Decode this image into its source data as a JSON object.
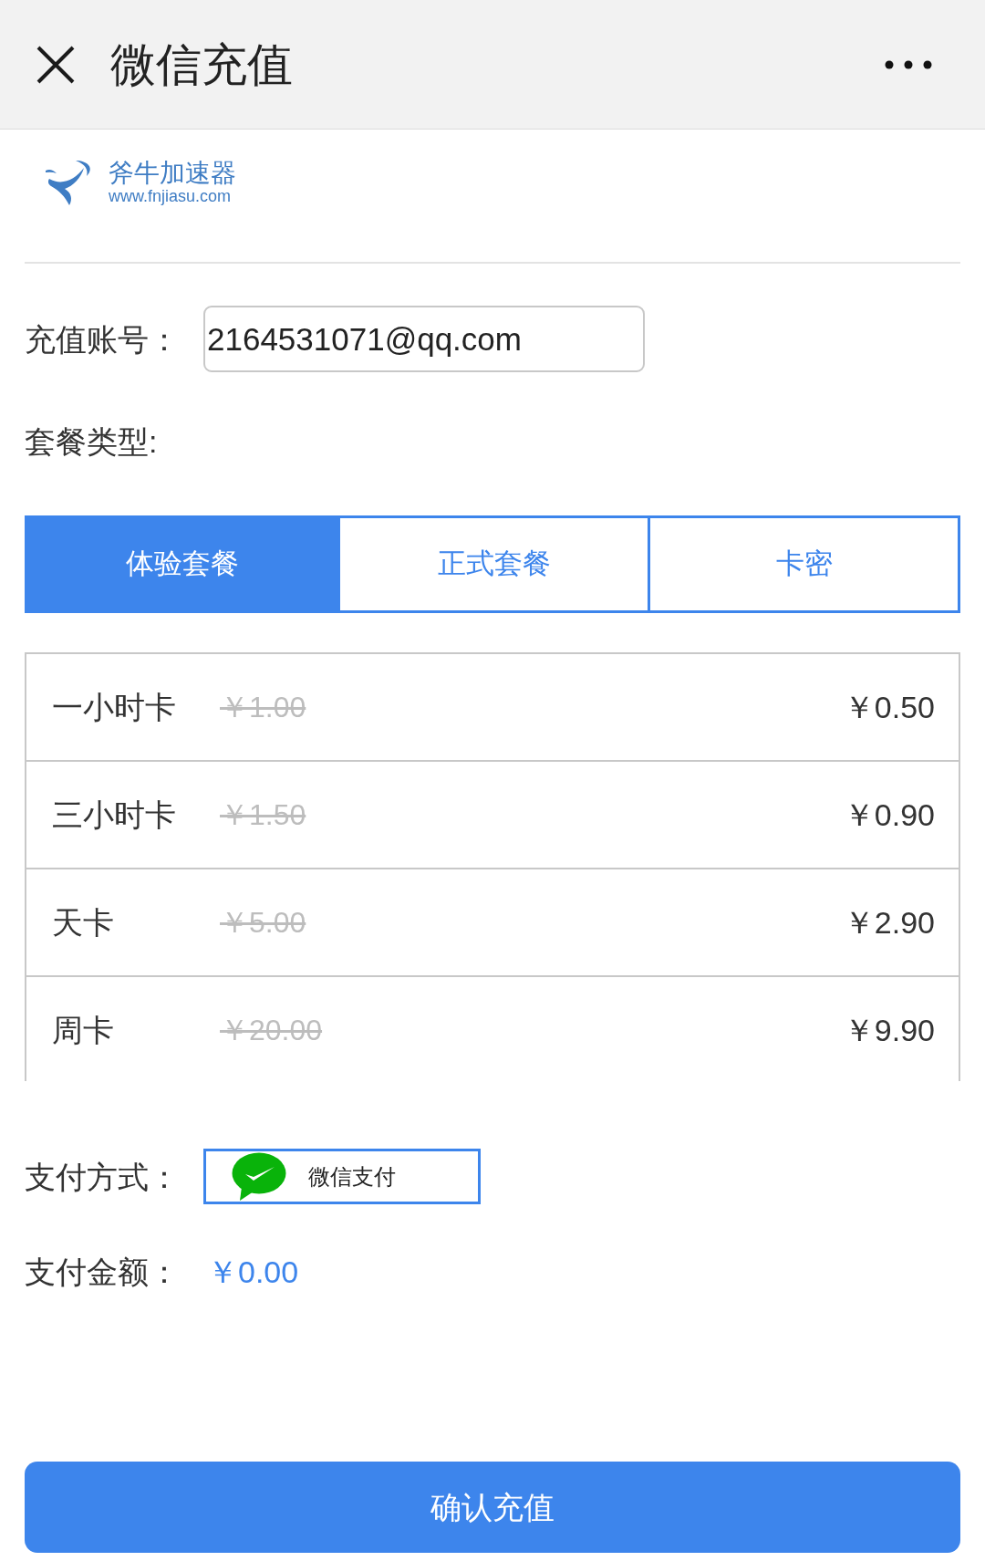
{
  "header": {
    "title": "微信充值"
  },
  "logo": {
    "name": "斧牛加速器",
    "url": "www.fnjiasu.com"
  },
  "account": {
    "label": "充值账号：",
    "value": "2164531071@qq.com"
  },
  "package_type": {
    "label": "套餐类型:",
    "tabs": [
      {
        "label": "体验套餐",
        "selected": true
      },
      {
        "label": "正式套餐",
        "selected": false
      },
      {
        "label": "卡密",
        "selected": false
      }
    ]
  },
  "packages": [
    {
      "name": "一小时卡",
      "original_price": "￥1.00",
      "price": "￥0.50",
      "selected": false
    },
    {
      "name": "三小时卡",
      "original_price": "￥1.50",
      "price": "￥0.90",
      "selected": false
    },
    {
      "name": "天卡",
      "original_price": "￥5.00",
      "price": "￥2.90",
      "selected": false
    },
    {
      "name": "周卡",
      "original_price": "￥20.00",
      "price": "￥9.90",
      "selected": false
    }
  ],
  "payment": {
    "label": "支付方式：",
    "methods": [
      {
        "label": "微信支付",
        "selected": true
      }
    ]
  },
  "amount": {
    "label": "支付金额：",
    "value": "￥0.00"
  },
  "confirm_button": {
    "label": "确认充值"
  }
}
